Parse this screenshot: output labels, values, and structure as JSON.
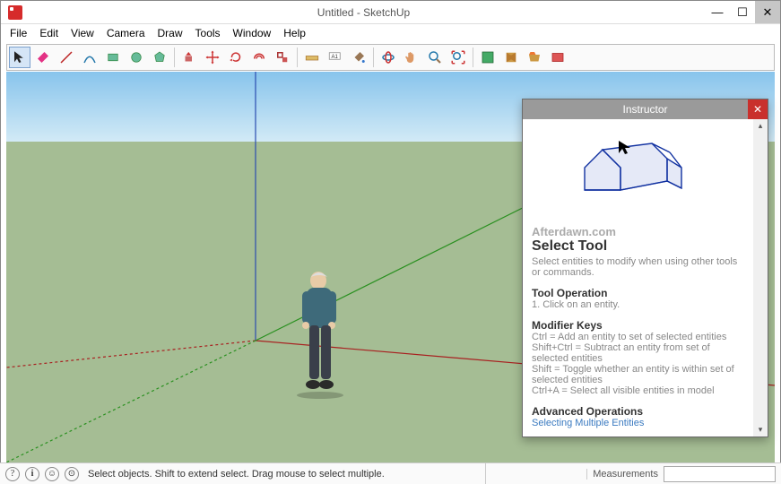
{
  "window": {
    "title": "Untitled - SketchUp"
  },
  "menu": {
    "items": [
      "File",
      "Edit",
      "View",
      "Camera",
      "Draw",
      "Tools",
      "Window",
      "Help"
    ]
  },
  "toolbar": {
    "selected_index": 0
  },
  "instructor": {
    "title": "Instructor",
    "brand": "Afterdawn.com",
    "tool_title": "Select Tool",
    "tool_desc": "Select entities to modify when using other tools or commands.",
    "operation_heading": "Tool Operation",
    "operation_text": "1.  Click on an entity.",
    "modifier_heading": "Modifier Keys",
    "mod1": "Ctrl = Add an entity to set of selected entities",
    "mod2": "Shift+Ctrl = Subtract an entity from set of selected entities",
    "mod3": "Shift = Toggle whether an entity is within set of selected entities",
    "mod4": "Ctrl+A = Select all visible entities in model",
    "advanced_heading": "Advanced Operations",
    "adv_link": "Selecting Multiple Entities"
  },
  "status": {
    "hint": "Select objects. Shift to extend select. Drag mouse to select multiple.",
    "measurements_label": "Measurements",
    "measurements_value": ""
  }
}
